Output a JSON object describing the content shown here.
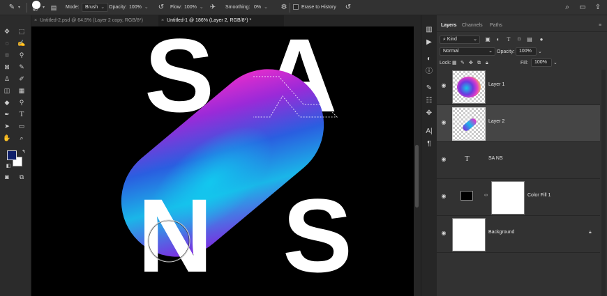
{
  "options_bar": {
    "brush_size": "60",
    "mode_label": "Mode:",
    "mode_value": "Brush",
    "opacity_label": "Opacity:",
    "opacity_value": "100%",
    "flow_label": "Flow:",
    "flow_value": "100%",
    "smoothing_label": "Smoothing:",
    "smoothing_value": "0%",
    "erase_history_label": "Erase to History"
  },
  "tabs": [
    {
      "label": "Untitled-2.psd @ 64,5% (Layer 2 copy, RGB/8*)",
      "active": false
    },
    {
      "label": "Untitled-1 @ 186% (Layer 2, RGB/8*) *",
      "active": true
    }
  ],
  "canvas": {
    "letters": [
      "S",
      "A",
      "N",
      "S"
    ]
  },
  "colors": {
    "foreground": "#0f1f6a",
    "background": "#ffffff",
    "canvas_bg": "#000000",
    "blob_magenta": "#d42bd0",
    "blob_violet": "#5a2ad8",
    "blob_cyan": "#12c3e6"
  },
  "panel": {
    "tabs": [
      "Layers",
      "Channels",
      "Paths"
    ],
    "filter_value": "Kind",
    "blend_mode": "Normal",
    "opacity_label": "Opacity:",
    "opacity_value": "100%",
    "lock_label": "Lock:",
    "fill_label": "Fill:",
    "fill_value": "100%"
  },
  "layers": [
    {
      "name": "Layer 1",
      "selected": false
    },
    {
      "name": "Layer 2",
      "selected": true
    },
    {
      "name": "SA NS",
      "selected": false
    },
    {
      "name": "Color Fill 1",
      "selected": false
    },
    {
      "name": "Background",
      "selected": false
    }
  ]
}
